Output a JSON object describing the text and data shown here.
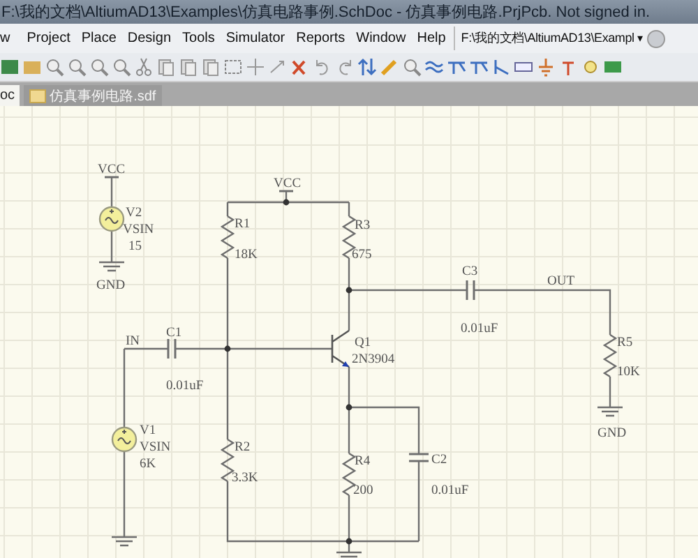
{
  "window": {
    "title": "F:\\我的文档\\AltiumAD13\\Examples\\仿真电路事例.SchDoc - 仿真事例电路.PrjPcb. Not signed in."
  },
  "menu": [
    "w",
    "Project",
    "Place",
    "Design",
    "Tools",
    "Simulator",
    "Reports",
    "Window",
    "Help"
  ],
  "path_field": {
    "value": "F:\\我的文档\\AltiumAD13\\Exampl",
    "dropdown": "▾"
  },
  "tabs": [
    {
      "label": "oc",
      "selected": true
    },
    {
      "label": "仿真事例电路.sdf",
      "selected": false
    }
  ],
  "schematic": {
    "power_labels": [
      "VCC",
      "VCC"
    ],
    "ground_labels": [
      "GND",
      "GND"
    ],
    "net_labels": [
      "IN",
      "OUT"
    ],
    "components": [
      {
        "kind": "source",
        "designator": "V2",
        "value": "VSIN",
        "parameter": "15"
      },
      {
        "kind": "resistor",
        "designator": "R1",
        "value": "18K"
      },
      {
        "kind": "resistor",
        "designator": "R3",
        "value": "675"
      },
      {
        "kind": "capacitor",
        "designator": "C3",
        "value": "0.01uF"
      },
      {
        "kind": "capacitor",
        "designator": "C1",
        "value": "0.01uF"
      },
      {
        "kind": "transistor",
        "designator": "Q1",
        "value": "2N3904"
      },
      {
        "kind": "resistor",
        "designator": "R5",
        "value": "10K"
      },
      {
        "kind": "source",
        "designator": "V1",
        "value": "VSIN",
        "parameter": "6K"
      },
      {
        "kind": "resistor",
        "designator": "R2",
        "value": "3.3K"
      },
      {
        "kind": "resistor",
        "designator": "R4",
        "value": "200"
      },
      {
        "kind": "capacitor",
        "designator": "C2",
        "value": "0.01uF"
      }
    ]
  }
}
